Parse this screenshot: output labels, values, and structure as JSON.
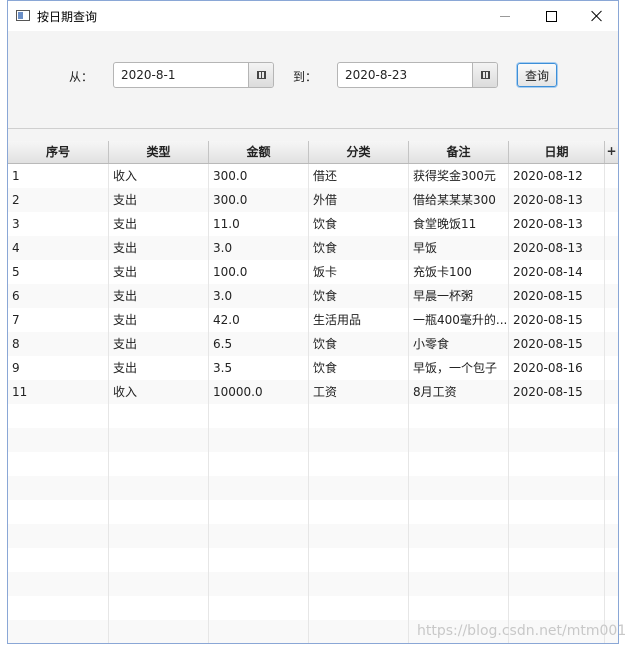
{
  "window": {
    "title": "按日期查询",
    "controls": {
      "minimize": "minimize",
      "maximize": "maximize",
      "close": "close"
    }
  },
  "filter": {
    "from_label": "从：",
    "from_value": "2020-8-1",
    "to_label": "到：",
    "to_value": "2020-8-23",
    "query_button": "查询"
  },
  "table": {
    "columns": [
      "序号",
      "类型",
      "金额",
      "分类",
      "备注",
      "日期"
    ],
    "menu_button": "+",
    "rows": [
      [
        "1",
        "收入",
        "300.0",
        "借还",
        "获得奖金300元",
        "2020-08-12"
      ],
      [
        "2",
        "支出",
        "300.0",
        "外借",
        "借给某某某300",
        "2020-08-13"
      ],
      [
        "3",
        "支出",
        "11.0",
        "饮食",
        "食堂晚饭11",
        "2020-08-13"
      ],
      [
        "4",
        "支出",
        "3.0",
        "饮食",
        "早饭",
        "2020-08-13"
      ],
      [
        "5",
        "支出",
        "100.0",
        "饭卡",
        "充饭卡100",
        "2020-08-14"
      ],
      [
        "6",
        "支出",
        "3.0",
        "饮食",
        "早晨一杯粥",
        "2020-08-15"
      ],
      [
        "7",
        "支出",
        "42.0",
        "生活用品",
        "一瓶400毫升的...",
        "2020-08-15"
      ],
      [
        "8",
        "支出",
        "6.5",
        "饮食",
        "小零食",
        "2020-08-15"
      ],
      [
        "9",
        "支出",
        "3.5",
        "饮食",
        "早饭，一个包子",
        "2020-08-16"
      ],
      [
        "11",
        "收入",
        "10000.0",
        "工资",
        "8月工资",
        "2020-08-15"
      ]
    ]
  },
  "watermark": "https://blog.csdn.net/mtm001"
}
